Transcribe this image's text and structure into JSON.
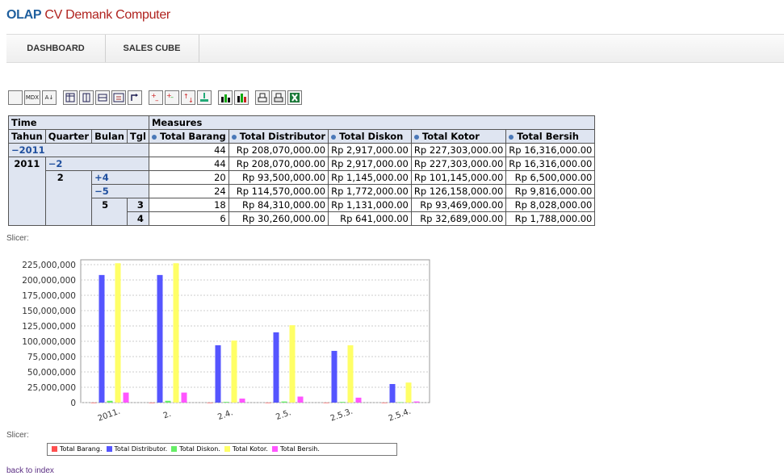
{
  "brand": {
    "part1": "OLAP",
    "part2": "CV Demank Computer"
  },
  "nav": [
    {
      "label": "DASHBOARD"
    },
    {
      "label": "SALES CUBE"
    }
  ],
  "toolbar": {
    "icons": [
      "cube-icon",
      "mdx-icon",
      "sort-icon",
      "pivot-icon",
      "columns-icon",
      "rows-icon",
      "hide-spans-icon",
      "swap-axes-icon",
      "drill-member-icon",
      "drill-position-icon",
      "drill-replace-icon",
      "drill-through-icon",
      "chart-icon",
      "chart-config-icon",
      "print-config-icon",
      "print-icon",
      "excel-icon"
    ],
    "mdx_text": "MDX",
    "sort_text": "A↓"
  },
  "table": {
    "time_header": "Time",
    "measures_header": "Measures",
    "dim_headers": [
      "Tahun",
      "Quarter",
      "Bulan",
      "Tgl"
    ],
    "measure_headers": [
      "Total Barang",
      "Total Distributor",
      "Total Diskon",
      "Total Kotor",
      "Total Bersih"
    ],
    "labels": {
      "r0": "−2011",
      "r1_year": "2011",
      "r1_quarter": "−2",
      "r2_quarter": "2",
      "r2_month": "+4",
      "r3_month": "−5",
      "r4_month": "5",
      "r4_day": "3",
      "r5_day": "4"
    },
    "rows": [
      [
        "44",
        "Rp 208,070,000.00",
        "Rp 2,917,000.00",
        "Rp 227,303,000.00",
        "Rp 16,316,000.00"
      ],
      [
        "44",
        "Rp 208,070,000.00",
        "Rp 2,917,000.00",
        "Rp 227,303,000.00",
        "Rp 16,316,000.00"
      ],
      [
        "20",
        "Rp 93,500,000.00",
        "Rp 1,145,000.00",
        "Rp 101,145,000.00",
        "Rp 6,500,000.00"
      ],
      [
        "24",
        "Rp 114,570,000.00",
        "Rp 1,772,000.00",
        "Rp 126,158,000.00",
        "Rp 9,816,000.00"
      ],
      [
        "18",
        "Rp 84,310,000.00",
        "Rp 1,131,000.00",
        "Rp 93,469,000.00",
        "Rp 8,028,000.00"
      ],
      [
        "6",
        "Rp 30,260,000.00",
        "Rp 641,000.00",
        "Rp 32,689,000.00",
        "Rp 1,788,000.00"
      ]
    ]
  },
  "slicer_label": "Slicer:",
  "back_link": "back to index",
  "chart_data": {
    "type": "bar",
    "categories": [
      "2011.",
      "2.",
      "2.4.",
      "2.5.",
      "2.5.3.",
      "2.5.4."
    ],
    "series": [
      {
        "name": "Total Barang.",
        "color": "#ff5050",
        "values": [
          44,
          44,
          20,
          24,
          18,
          6
        ]
      },
      {
        "name": "Total Distributor.",
        "color": "#5555ff",
        "values": [
          208070000,
          208070000,
          93500000,
          114570000,
          84310000,
          30260000
        ]
      },
      {
        "name": "Total Diskon.",
        "color": "#66ee66",
        "values": [
          2917000,
          2917000,
          1145000,
          1772000,
          1131000,
          641000
        ]
      },
      {
        "name": "Total Kotor.",
        "color": "#ffff66",
        "values": [
          227303000,
          227303000,
          101145000,
          126158000,
          93469000,
          32689000
        ]
      },
      {
        "name": "Total Bersih.",
        "color": "#ff55ff",
        "values": [
          16316000,
          16316000,
          6500000,
          9816000,
          8028000,
          1788000
        ]
      }
    ],
    "yticks": [
      "0",
      "25,000,000",
      "50,000,000",
      "75,000,000",
      "100,000,000",
      "125,000,000",
      "150,000,000",
      "175,000,000",
      "200,000,000",
      "225,000,000"
    ],
    "ylim": [
      0,
      225000000
    ],
    "grid": true,
    "legend": "bottom"
  }
}
